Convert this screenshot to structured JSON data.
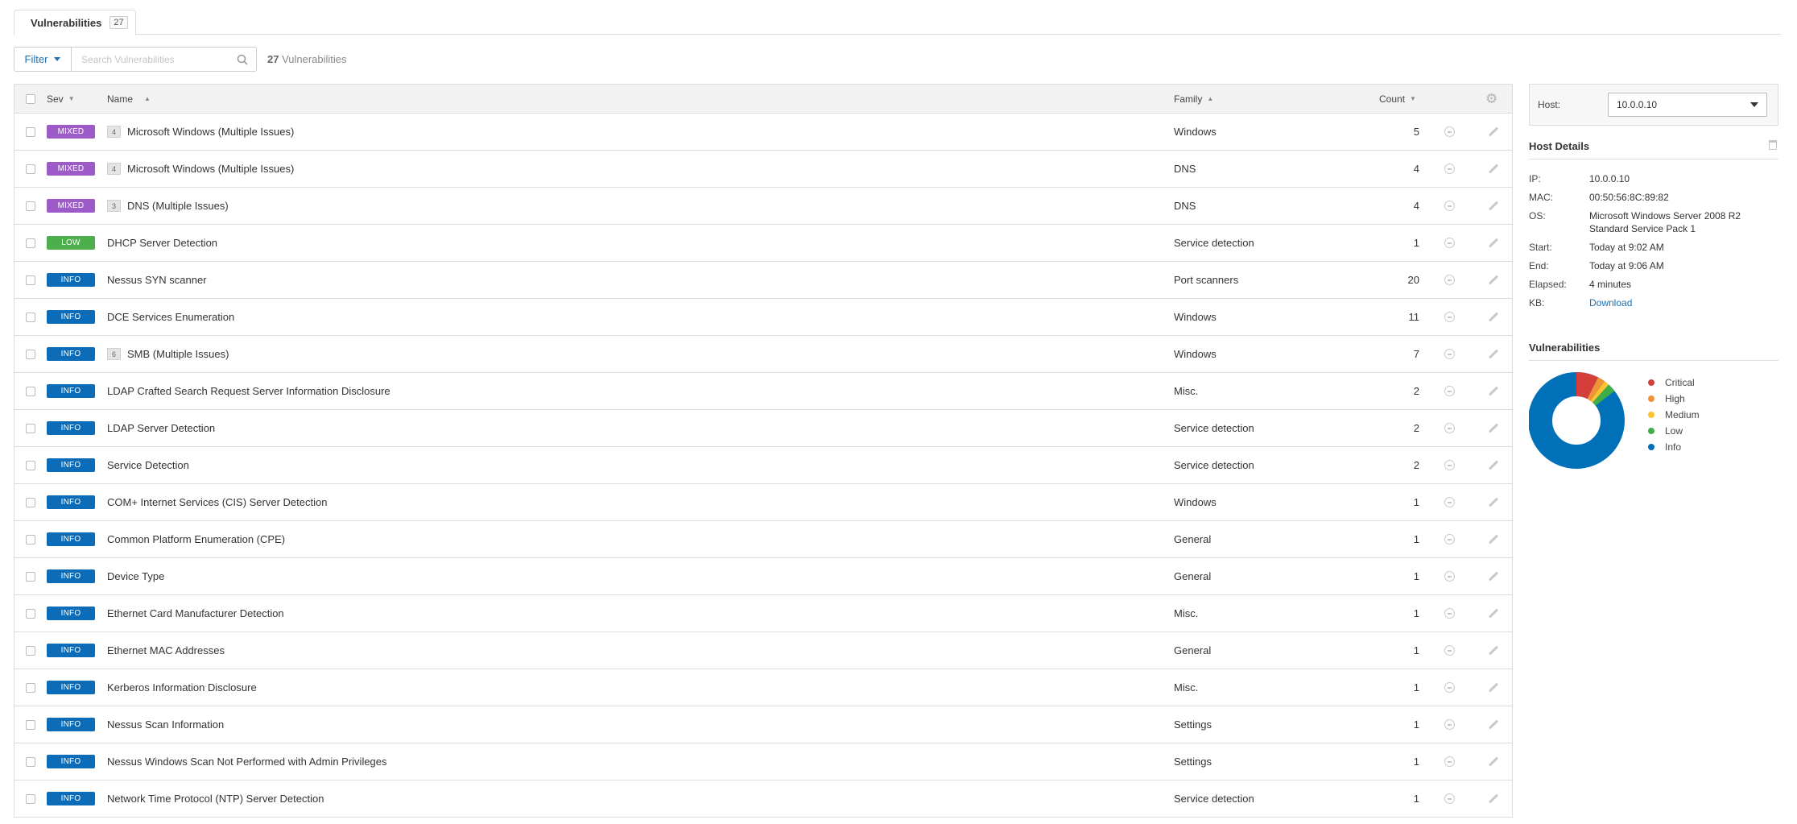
{
  "tab": {
    "label": "Vulnerabilities",
    "count": "27"
  },
  "toolbar": {
    "filter_label": "Filter",
    "search_placeholder": "Search Vulnerabilities",
    "count_number": "27",
    "count_suffix": " Vulnerabilities"
  },
  "table": {
    "columns": {
      "sev": "Sev",
      "name": "Name",
      "family": "Family",
      "count": "Count"
    },
    "rows": [
      {
        "sev": "MIXED",
        "sev_class": "mixed",
        "group": "4",
        "name": "Microsoft Windows (Multiple Issues)",
        "family": "Windows",
        "count": "5"
      },
      {
        "sev": "MIXED",
        "sev_class": "mixed",
        "group": "4",
        "name": "Microsoft Windows (Multiple Issues)",
        "family": "DNS",
        "count": "4"
      },
      {
        "sev": "MIXED",
        "sev_class": "mixed",
        "group": "3",
        "name": "DNS (Multiple Issues)",
        "family": "DNS",
        "count": "4"
      },
      {
        "sev": "LOW",
        "sev_class": "low",
        "group": "",
        "name": "DHCP Server Detection",
        "family": "Service detection",
        "count": "1"
      },
      {
        "sev": "INFO",
        "sev_class": "info",
        "group": "",
        "name": "Nessus SYN scanner",
        "family": "Port scanners",
        "count": "20"
      },
      {
        "sev": "INFO",
        "sev_class": "info",
        "group": "",
        "name": "DCE Services Enumeration",
        "family": "Windows",
        "count": "11"
      },
      {
        "sev": "INFO",
        "sev_class": "info",
        "group": "6",
        "name": "SMB (Multiple Issues)",
        "family": "Windows",
        "count": "7"
      },
      {
        "sev": "INFO",
        "sev_class": "info",
        "group": "",
        "name": "LDAP Crafted Search Request Server Information Disclosure",
        "family": "Misc.",
        "count": "2"
      },
      {
        "sev": "INFO",
        "sev_class": "info",
        "group": "",
        "name": "LDAP Server Detection",
        "family": "Service detection",
        "count": "2"
      },
      {
        "sev": "INFO",
        "sev_class": "info",
        "group": "",
        "name": "Service Detection",
        "family": "Service detection",
        "count": "2"
      },
      {
        "sev": "INFO",
        "sev_class": "info",
        "group": "",
        "name": "COM+ Internet Services (CIS) Server Detection",
        "family": "Windows",
        "count": "1"
      },
      {
        "sev": "INFO",
        "sev_class": "info",
        "group": "",
        "name": "Common Platform Enumeration (CPE)",
        "family": "General",
        "count": "1"
      },
      {
        "sev": "INFO",
        "sev_class": "info",
        "group": "",
        "name": "Device Type",
        "family": "General",
        "count": "1"
      },
      {
        "sev": "INFO",
        "sev_class": "info",
        "group": "",
        "name": "Ethernet Card Manufacturer Detection",
        "family": "Misc.",
        "count": "1"
      },
      {
        "sev": "INFO",
        "sev_class": "info",
        "group": "",
        "name": "Ethernet MAC Addresses",
        "family": "General",
        "count": "1"
      },
      {
        "sev": "INFO",
        "sev_class": "info",
        "group": "",
        "name": "Kerberos Information Disclosure",
        "family": "Misc.",
        "count": "1"
      },
      {
        "sev": "INFO",
        "sev_class": "info",
        "group": "",
        "name": "Nessus Scan Information",
        "family": "Settings",
        "count": "1"
      },
      {
        "sev": "INFO",
        "sev_class": "info",
        "group": "",
        "name": "Nessus Windows Scan Not Performed with Admin Privileges",
        "family": "Settings",
        "count": "1"
      },
      {
        "sev": "INFO",
        "sev_class": "info",
        "group": "",
        "name": "Network Time Protocol (NTP) Server Detection",
        "family": "Service detection",
        "count": "1"
      }
    ]
  },
  "host": {
    "label": "Host:",
    "selected": "10.0.0.10"
  },
  "host_details": {
    "title": "Host Details",
    "fields": [
      {
        "label": "IP:",
        "value": "10.0.0.10"
      },
      {
        "label": "MAC:",
        "value": "00:50:56:8C:89:82"
      },
      {
        "label": "OS:",
        "value": "Microsoft Windows Server 2008 R2 Standard Service Pack 1"
      },
      {
        "label": "Start:",
        "value": "Today at 9:02 AM"
      },
      {
        "label": "End:",
        "value": "Today at 9:06 AM"
      },
      {
        "label": "Elapsed:",
        "value": "4 minutes"
      },
      {
        "label": "KB:",
        "value": "Download",
        "link": true
      }
    ]
  },
  "vuln_chart": {
    "title": "Vulnerabilities",
    "legend": [
      {
        "label": "Critical",
        "color": "#d43f3a"
      },
      {
        "label": "High",
        "color": "#ee9336"
      },
      {
        "label": "Medium",
        "color": "#fdc431"
      },
      {
        "label": "Low",
        "color": "#3fae49"
      },
      {
        "label": "Info",
        "color": "#0071b9"
      }
    ]
  },
  "colors": {
    "mixed": "#9d5bc7",
    "low": "#4cae4c",
    "info": "#0c6cb7",
    "link": "#1f6fb5"
  }
}
